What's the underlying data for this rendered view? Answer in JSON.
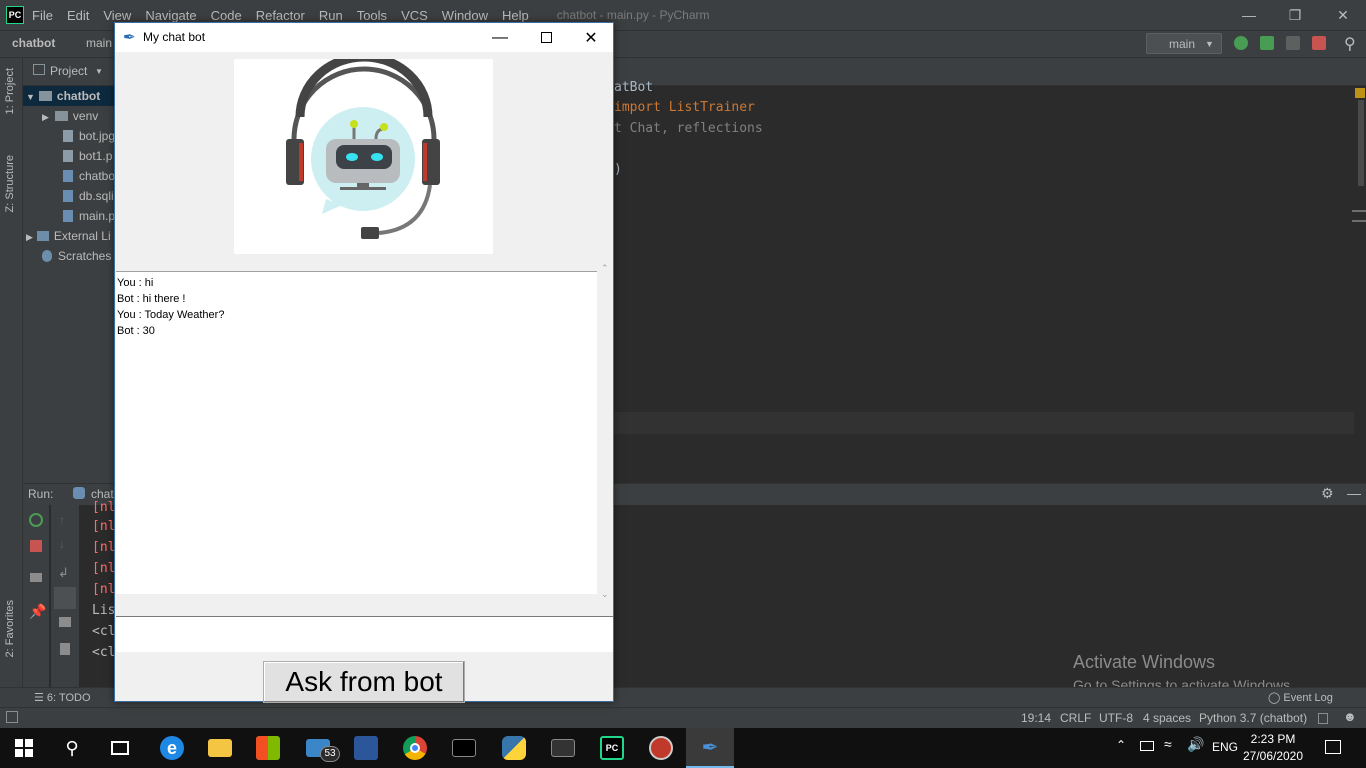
{
  "ide": {
    "logo": "PC",
    "menu": [
      "File",
      "Edit",
      "View",
      "Navigate",
      "Code",
      "Refactor",
      "Run",
      "Tools",
      "VCS",
      "Window",
      "Help"
    ],
    "title": "chatbot - main.py - PyCharm",
    "breadcrumb": {
      "project": "chatbot",
      "file": "main"
    },
    "run_config": "main",
    "tool_windows": {
      "project": "1: Project",
      "structure": "Z: Structure",
      "favorites": "2: Favorites"
    },
    "project_panel": {
      "header": "Project",
      "items": [
        {
          "label": "chatbot",
          "kind": "folder"
        },
        {
          "label": "venv",
          "kind": "folder"
        },
        {
          "label": "bot.jpg",
          "kind": "file"
        },
        {
          "label": "bot1.p",
          "kind": "file"
        },
        {
          "label": "chatbo",
          "kind": "file"
        },
        {
          "label": "db.sqli",
          "kind": "file"
        },
        {
          "label": "main.p",
          "kind": "file"
        },
        {
          "label": "External Li",
          "kind": "lib"
        },
        {
          "label": "Scratches",
          "kind": "scratch"
        }
      ]
    },
    "code_lines": [
      {
        "text": "atBot",
        "color": "#a9b7c6"
      },
      {
        "text": "import ListTrainer",
        "color": "#cc7832"
      },
      {
        "text": "t Chat, reflections",
        "color": "#808080"
      },
      {
        "text": ")",
        "color": "#a9b7c6"
      }
    ],
    "run_panel": {
      "label": "Run:",
      "config": "chat",
      "console_lines": [
        "[nl",
        "[nl",
        "[nl",
        "[nl",
        "[nl",
        "Lis",
        "<cl",
        "<cl"
      ]
    },
    "activate": {
      "line1": "Activate Windows",
      "line2": "Go to Settings to activate Windows."
    },
    "bottom_tools": {
      "todo": "6: TODO",
      "event_log": "Event Log"
    },
    "status": {
      "position": "19:14",
      "line_sep": "CRLF",
      "encoding": "UTF-8",
      "indent": "4 spaces",
      "interpreter": "Python 3.7 (chatbot)"
    }
  },
  "chat_window": {
    "title": "My chat bot",
    "messages": [
      "You : hi",
      "Bot : hi there !",
      "You : Today Weather?",
      "Bot : 30"
    ],
    "entry_value": "",
    "button_label": "Ask from bot"
  },
  "taskbar": {
    "badge": "53",
    "language": "ENG",
    "time": "2:23 PM",
    "date": "27/06/2020"
  }
}
